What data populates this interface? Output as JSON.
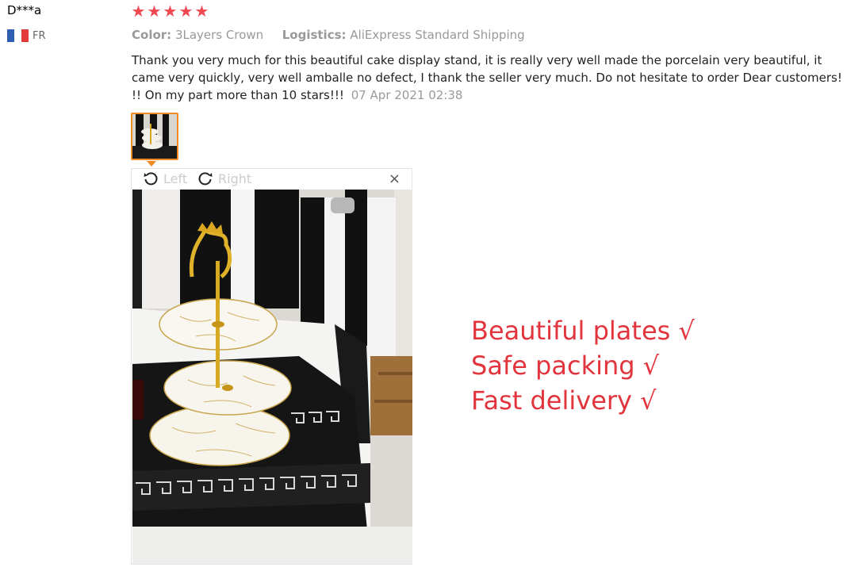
{
  "reviewer": {
    "name": "D***a",
    "country_code": "FR",
    "flag_colors": [
      "#2f5fb3",
      "#ffffff",
      "#e23a3a"
    ]
  },
  "rating": {
    "stars": 5,
    "max": 5,
    "star_glyph": "★",
    "color": "#f04850"
  },
  "meta": {
    "color_label": "Color:",
    "color_value": "3Layers Crown",
    "logistics_label": "Logistics:",
    "logistics_value": "AliExpress Standard Shipping"
  },
  "review": {
    "text": "Thank you very much for this beautiful cake display stand, it is really very well made the porcelain very beautiful, it came very quickly, very well amballe no defect, I thank the seller very much. Do not hesitate to order Dear customers! !! On my part more than 10 stars!!!",
    "date": "07 Apr 2021 02:38"
  },
  "viewer": {
    "rotate_left_label": "Left",
    "rotate_right_label": "Right",
    "close_glyph": "×"
  },
  "overlay": {
    "lines": [
      "Beautiful plates √",
      "Safe packing √",
      "Fast delivery √"
    ],
    "color": "#e2343c"
  },
  "colors": {
    "accent_orange": "#f08a24",
    "muted_text": "#999999"
  }
}
